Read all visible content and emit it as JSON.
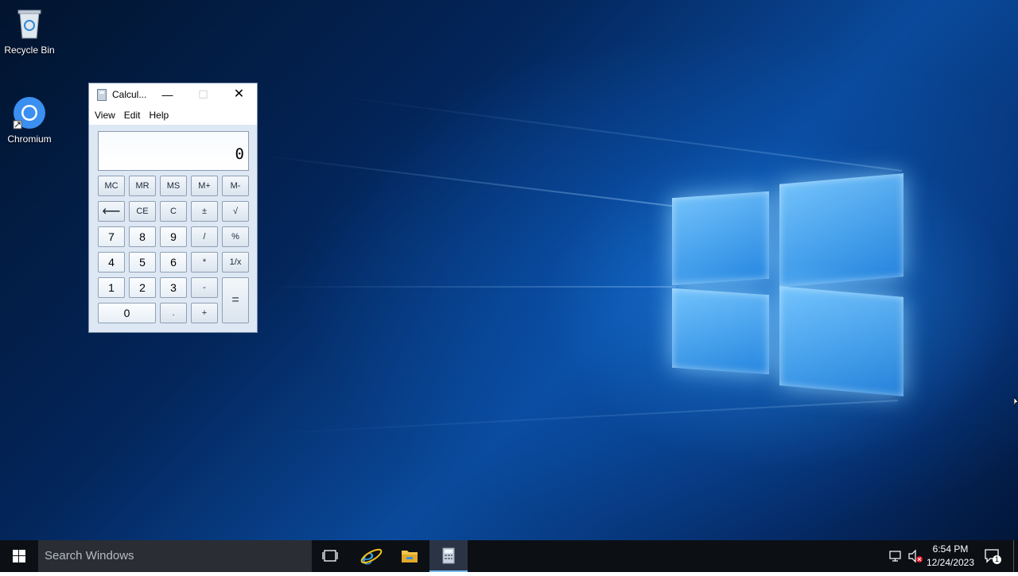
{
  "desktop": {
    "icons": [
      {
        "label": "Recycle Bin",
        "icon": "recycle-bin-icon"
      },
      {
        "label": "Chromium",
        "icon": "chromium-icon"
      }
    ]
  },
  "calculator": {
    "title": "Calcul...",
    "menu": [
      "View",
      "Edit",
      "Help"
    ],
    "display_value": "0",
    "keys": {
      "mc": "MC",
      "mr": "MR",
      "ms": "MS",
      "mplus": "M+",
      "mminus": "M-",
      "backspace": "⟵",
      "ce": "CE",
      "c": "C",
      "plusminus": "±",
      "sqrt": "√",
      "k7": "7",
      "k8": "8",
      "k9": "9",
      "divide": "/",
      "percent": "%",
      "k4": "4",
      "k5": "5",
      "k6": "6",
      "multiply": "*",
      "reciprocal": "1/x",
      "k1": "1",
      "k2": "2",
      "k3": "3",
      "minus": "-",
      "equals": "=",
      "k0": "0",
      "decimal": ".",
      "plus": "+"
    }
  },
  "taskbar": {
    "search_placeholder": "Search Windows",
    "pinned": [
      "task-view-icon",
      "internet-explorer-icon",
      "file-explorer-icon",
      "calculator-icon"
    ],
    "time": "6:54 PM",
    "date": "12/24/2023",
    "notification_count": "1"
  },
  "colors": {
    "taskbar": "#0c0f14",
    "search_box": "#2a2d33",
    "accent": "#76b9ed"
  }
}
